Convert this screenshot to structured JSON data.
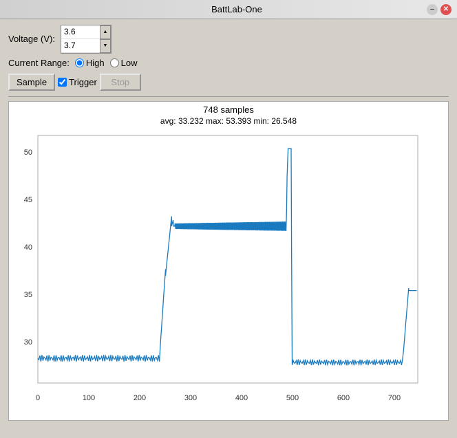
{
  "titleBar": {
    "title": "BattLab-One",
    "minimizeLabel": "–",
    "closeLabel": "✕"
  },
  "voltage": {
    "label": "Voltage (V):",
    "value1": "3.6",
    "value2": "3.7"
  },
  "currentRange": {
    "label": "Current Range:",
    "highLabel": "High",
    "lowLabel": "Low",
    "selected": "High"
  },
  "buttons": {
    "sample": "Sample",
    "trigger": "Trigger",
    "stop": "Stop"
  },
  "chart": {
    "samples": "748 samples",
    "stats": "avg: 33.232  max: 53.393  min: 26.548"
  }
}
